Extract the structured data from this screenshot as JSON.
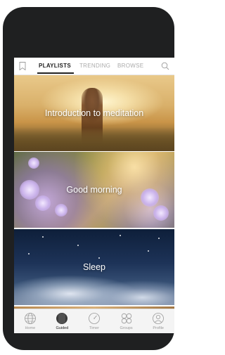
{
  "topnav": {
    "tabs": [
      {
        "label": "PLAYLISTS",
        "active": true
      },
      {
        "label": "TRENDING",
        "active": false
      },
      {
        "label": "BROWSE",
        "active": false
      }
    ],
    "left_icon": "bookmark-icon",
    "right_icon": "search-icon"
  },
  "cards": [
    {
      "title": "Introduction to meditation"
    },
    {
      "title": "Good morning"
    },
    {
      "title": "Sleep"
    }
  ],
  "bottomnav": {
    "items": [
      {
        "label": "Home",
        "icon": "globe-icon",
        "active": false
      },
      {
        "label": "Guided",
        "icon": "guided-icon",
        "active": true
      },
      {
        "label": "Timer",
        "icon": "timer-icon",
        "active": false
      },
      {
        "label": "Groups",
        "icon": "groups-icon",
        "active": false
      },
      {
        "label": "Profile",
        "icon": "profile-icon",
        "active": false
      }
    ]
  },
  "colors": {
    "phone_frame": "#1f2021",
    "active_text": "#222222",
    "inactive_text": "#aaaaaa"
  }
}
